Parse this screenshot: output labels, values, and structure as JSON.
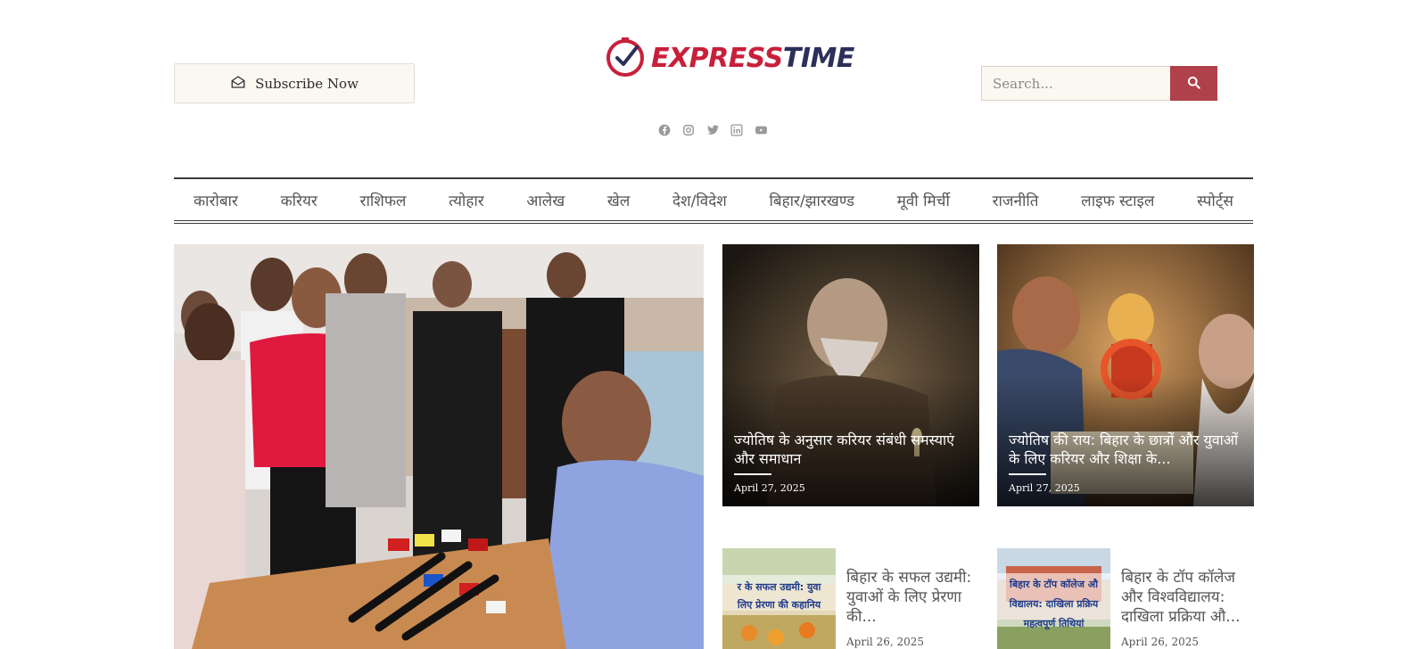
{
  "header": {
    "subscribe_label": "Subscribe Now",
    "logo": {
      "part1": "EXPRESS",
      "part2": "TIME"
    },
    "search": {
      "placeholder": "Search..."
    },
    "social": [
      "facebook-icon",
      "instagram-icon",
      "twitter-icon",
      "linkedin-icon",
      "youtube-icon"
    ]
  },
  "nav": {
    "items": [
      {
        "label": "कारोबार"
      },
      {
        "label": "करियर"
      },
      {
        "label": "राशिफल"
      },
      {
        "label": "त्योहार"
      },
      {
        "label": "आलेख"
      },
      {
        "label": "खेल"
      },
      {
        "label": "देश/विदेश"
      },
      {
        "label": "बिहार/झारखण्ड"
      },
      {
        "label": "मूवी मिर्ची"
      },
      {
        "label": "राजनीति"
      },
      {
        "label": "लाइफ स्टाइल"
      },
      {
        "label": "स्पोर्ट्स"
      }
    ]
  },
  "featured": {
    "cards": [
      {
        "title": "ज्योतिष के अनुसार करियर संबंधी समस्याएं और समाधान",
        "date": "April 27, 2025"
      },
      {
        "title": "ज्योतिष की राय: बिहार के छात्रों और युवाओं के लिए करियर और शिक्षा के...",
        "date": "April 27, 2025"
      }
    ],
    "small": [
      {
        "title": "बिहार के सफल उद्यमी: युवाओं के लिए प्रेरणा की...",
        "thumb_text_1": "र के सफल उद्यमी: युवा",
        "thumb_text_2": "लिए प्रेरणा की कहानिय",
        "date": "April 26, 2025"
      },
      {
        "title": "बिहार के टॉप कॉलेज और विश्वविद्यालय: दाखिला प्रक्रिया औ...",
        "thumb_text_1": "बिहार के टॉप कॉलेज औ",
        "thumb_text_2": "विद्यालय: दाखिला प्रक्रिय",
        "thumb_text_3": "महत्वपूर्ण तिथियां",
        "date": "April 26, 2025"
      }
    ]
  },
  "colors": {
    "brand_red": "#c8203a",
    "brand_navy": "#2b2f5a",
    "search_button": "#b0404a"
  }
}
